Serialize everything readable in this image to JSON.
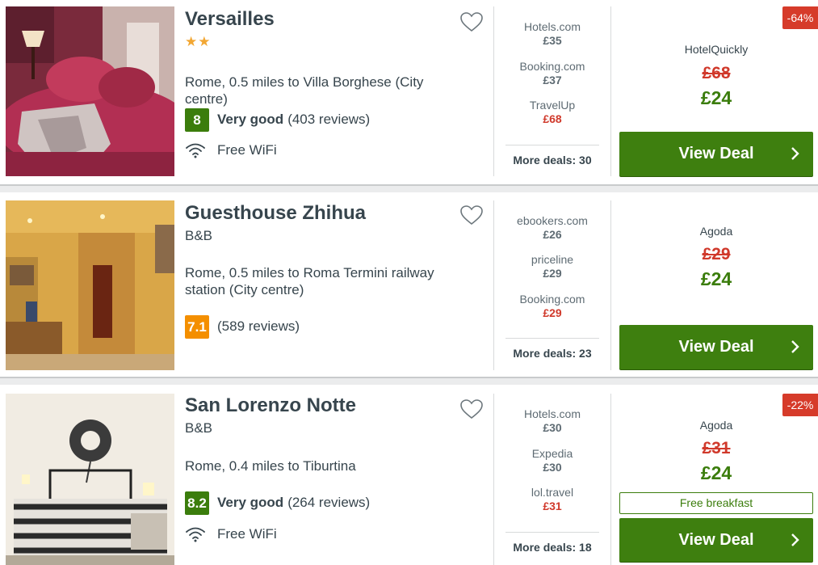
{
  "hotels": [
    {
      "name": "Versailles",
      "stars": "★★",
      "type": "",
      "location": "Rome, 0.5 miles to Villa Borghese (City centre)",
      "score": "8",
      "rating_label": "Very good",
      "reviews": "(403 reviews)",
      "amenity": "Free WiFi",
      "deals": [
        {
          "provider": "Hotels.com",
          "price": "£35"
        },
        {
          "provider": "Booking.com",
          "price": "£37"
        },
        {
          "provider": "TravelUp",
          "price": "£68"
        }
      ],
      "more_deals": "More deals: 30",
      "discount": "-64%",
      "main_provider": "HotelQuickly",
      "old_price": "£68",
      "new_price": "£24",
      "extra": "",
      "cta": "View Deal"
    },
    {
      "name": "Guesthouse Zhihua",
      "stars": "",
      "type": "B&B",
      "location": "Rome, 0.5 miles to Roma Termini railway station (City centre)",
      "score": "7.1",
      "rating_label": "",
      "reviews": "(589 reviews)",
      "amenity": "",
      "deals": [
        {
          "provider": "ebookers.com",
          "price": "£26"
        },
        {
          "provider": "priceline",
          "price": "£29"
        },
        {
          "provider": "Booking.com",
          "price": "£29"
        }
      ],
      "more_deals": "More deals: 23",
      "discount": "",
      "main_provider": "Agoda",
      "old_price": "£29",
      "new_price": "£24",
      "extra": "",
      "cta": "View Deal"
    },
    {
      "name": "San Lorenzo Notte",
      "stars": "",
      "type": "B&B",
      "location": "Rome, 0.4 miles to Tiburtina",
      "score": "8.2",
      "rating_label": "Very good",
      "reviews": "(264 reviews)",
      "amenity": "Free WiFi",
      "deals": [
        {
          "provider": "Hotels.com",
          "price": "£30"
        },
        {
          "provider": "Expedia",
          "price": "£30"
        },
        {
          "provider": "lol.travel",
          "price": "£31"
        }
      ],
      "more_deals": "More deals: 18",
      "discount": "-22%",
      "main_provider": "Agoda",
      "old_price": "£31",
      "new_price": "£24",
      "extra": "Free breakfast",
      "cta": "View Deal"
    }
  ],
  "colors": {
    "green": "#3e7f0f",
    "score_green": "#3b7d0c",
    "score_orange": "#f48f00",
    "red": "#d0392b",
    "badge_red": "#d63b2a"
  }
}
